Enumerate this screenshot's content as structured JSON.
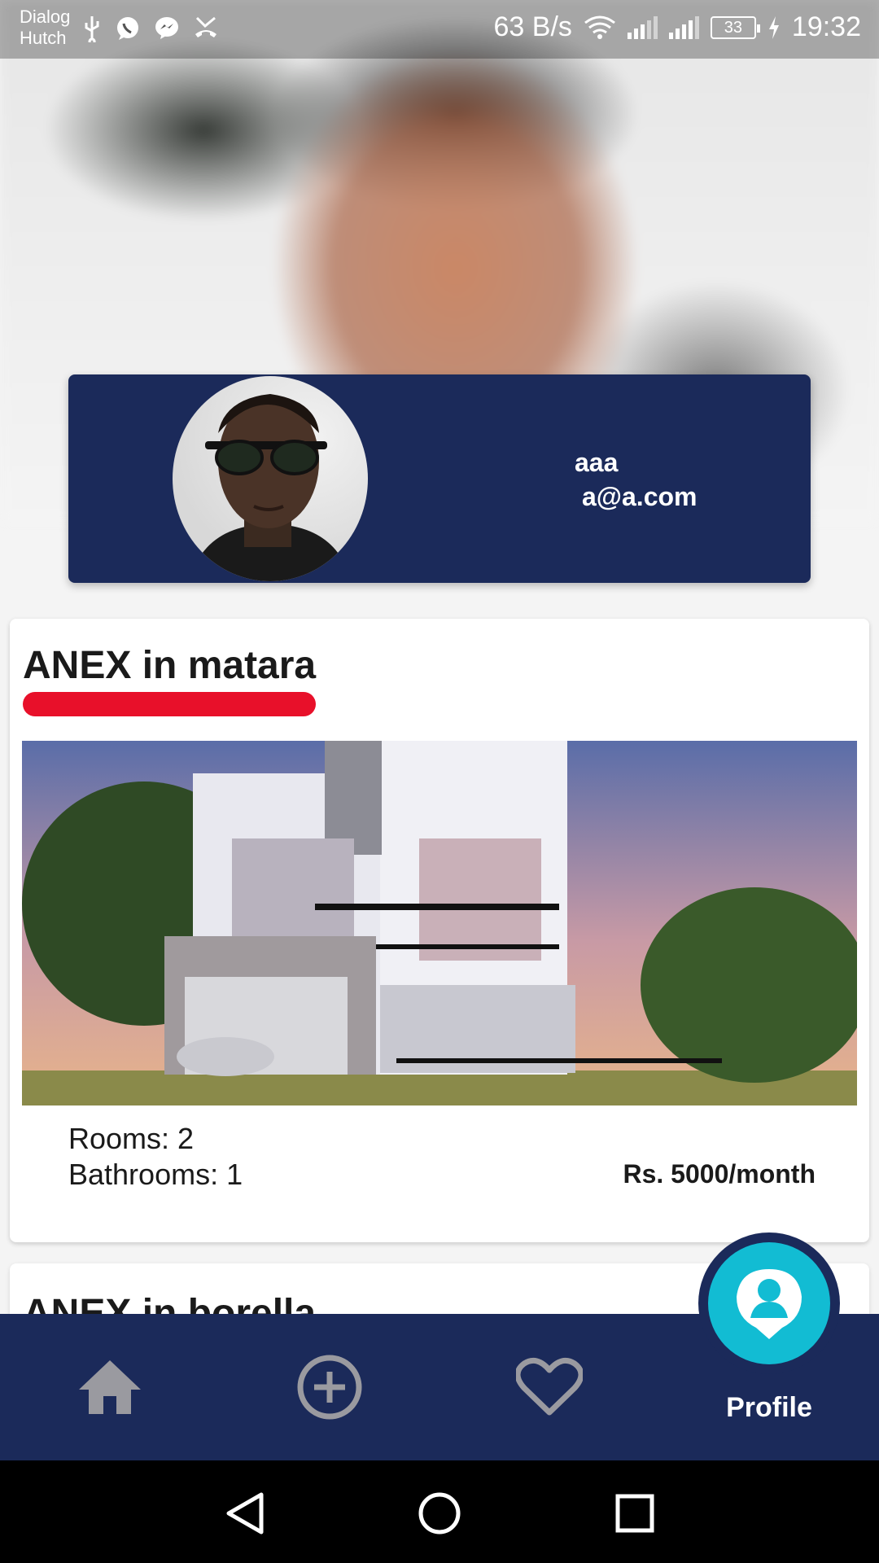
{
  "status_bar": {
    "carrier_1": "Dialog",
    "carrier_2": "Hutch",
    "net_speed": "63 B/s",
    "battery": "33",
    "time": "19:32",
    "icons": [
      "usb-icon",
      "whatsapp-icon",
      "messenger-icon",
      "missed-call-icon",
      "wifi-icon",
      "signal-icon",
      "signal-icon",
      "battery-icon",
      "charging-icon"
    ]
  },
  "profile": {
    "name": "aaa",
    "email": "a@a.com"
  },
  "listings": [
    {
      "title": "ANEX in matara",
      "rooms": "Rooms: 2",
      "bathrooms": "Bathrooms: 1",
      "price": "Rs. 5000/month"
    },
    {
      "title": "ANEX in borella"
    }
  ],
  "bottom_nav": {
    "items": [
      {
        "icon": "home-icon"
      },
      {
        "icon": "add-circle-icon"
      },
      {
        "icon": "heart-icon"
      },
      {
        "icon": "profile-icon",
        "label": "Profile",
        "active": true
      }
    ]
  },
  "colors": {
    "primary": "#1b2a5a",
    "accent": "#12bcd3",
    "underline": "#e8102a"
  }
}
